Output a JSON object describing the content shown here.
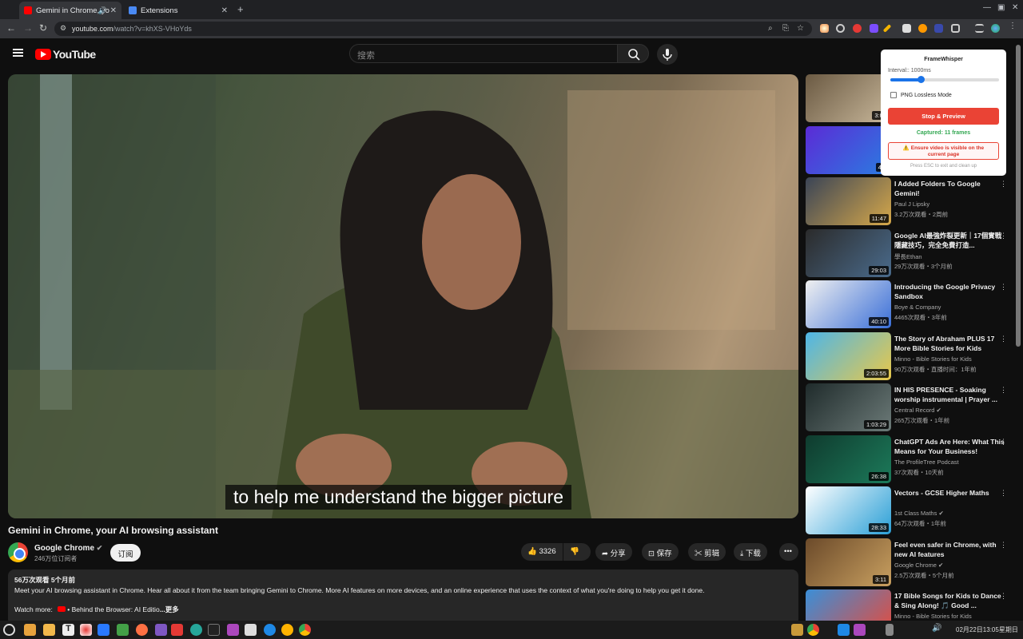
{
  "browser": {
    "tabs": [
      {
        "title": "Gemini in Chrome, yo",
        "active": true
      },
      {
        "title": "Extensions",
        "active": false
      }
    ],
    "url_host": "youtube.com",
    "url_path": "/watch?v=khXS-VHoYds"
  },
  "youtube": {
    "logo_text": "YouTube",
    "search_placeholder": "搜索"
  },
  "video": {
    "caption": "to help me understand the bigger picture",
    "title": "Gemini in Chrome, your AI browsing assistant",
    "channel": "Google Chrome",
    "subscribers": "246万位订阅者",
    "subscribe_label": "订阅",
    "likes": "3326",
    "share_label": "分享",
    "save_label": "保存",
    "clip_label": "剪辑",
    "download_label": "下载",
    "views_age": "56万次观看  5个月前",
    "description": "Meet your AI browsing assistant in Chrome. Hear all about it from the team bringing Gemini to Chrome. More AI features on more devices, and an online experience that uses the context of what you're doing to help you get it done.",
    "watch_more_label": "Watch more:",
    "watch_more_link": "• Behind the Browser: AI Editio",
    "more_label": "...更多"
  },
  "recommendations": [
    {
      "title": "",
      "channel": "",
      "meta": "",
      "duration": "3:00",
      "colors": [
        "#6b5a43",
        "#c8b79a"
      ]
    },
    {
      "title": "",
      "channel": "",
      "meta": "",
      "duration": "46:",
      "colors": [
        "#5b2bd6",
        "#2a7de1"
      ]
    },
    {
      "title": "I Added Folders To Google Gemini!",
      "channel": "Paul J Lipsky",
      "meta": "3.2万次观看・2周前",
      "duration": "11:47",
      "colors": [
        "#3a4456",
        "#d6a84a"
      ]
    },
    {
      "title": "Google AI最強炸裂更新｜17個實戰隱藏技巧，完全免費打造...",
      "channel": "學長Ethan",
      "meta": "29万次观看・3个月前",
      "duration": "29:03",
      "colors": [
        "#2b2b2b",
        "#4a6b8c"
      ]
    },
    {
      "title": "Introducing the Google Privacy Sandbox",
      "channel": "Boye & Company",
      "meta": "4465次观看・3年前",
      "duration": "40:10",
      "colors": [
        "#f0f0f0",
        "#3a6fd8"
      ]
    },
    {
      "title": "The Story of Abraham PLUS 17 More Bible Stories for Kids",
      "channel": "Minno - Bible Stories for Kids",
      "meta": "90万次观看・直播时间：1年前",
      "duration": "2:03:55",
      "colors": [
        "#4db6e8",
        "#e8c84a"
      ]
    },
    {
      "title": "IN HIS PRESENCE - Soaking worship instrumental | Prayer ...",
      "channel": "Central Record",
      "meta": "265万次观看・1年前",
      "duration": "1:03:29",
      "colors": [
        "#1f2b2b",
        "#6c7a78"
      ]
    },
    {
      "title": "ChatGPT Ads Are Here: What This Means for Your Business!",
      "channel": "The ProfileTree Podcast",
      "meta": "37次观看・10天前",
      "duration": "26:38",
      "colors": [
        "#0f3b2e",
        "#1c7a5a"
      ]
    },
    {
      "title": "Vectors - GCSE Higher Maths",
      "channel": "1st Class Maths",
      "meta": "64万次观看・1年前",
      "duration": "28:33",
      "colors": [
        "#ffffff",
        "#2a9fd6"
      ]
    },
    {
      "title": "Feel even safer in Chrome, with new AI features",
      "channel": "Google Chrome",
      "meta": "2.5万次观看・5个月前",
      "duration": "3:11",
      "colors": [
        "#6b4a2a",
        "#c9a060"
      ]
    },
    {
      "title": "17 Bible Songs for Kids to Dance & Sing Along! 🎵 Good ...",
      "channel": "Minno - Bible Stories for Kids",
      "meta": "",
      "duration": "",
      "colors": [
        "#3a8fd8",
        "#e84a3a"
      ]
    }
  ],
  "framewhisper": {
    "title": "FrameWhisper",
    "interval_label": "Interval:: 1000ms",
    "interval_fraction": 0.28,
    "png_label": "PNG Lossless Mode",
    "stop_label": "Stop & Preview",
    "captured": "Captured: 11 frames",
    "warning": "⚠️ Ensure video is visible on the current page",
    "esc_hint": "Press ESC to exit and clean up"
  },
  "taskbar": {
    "clock": "02月22日13:05星期日"
  }
}
